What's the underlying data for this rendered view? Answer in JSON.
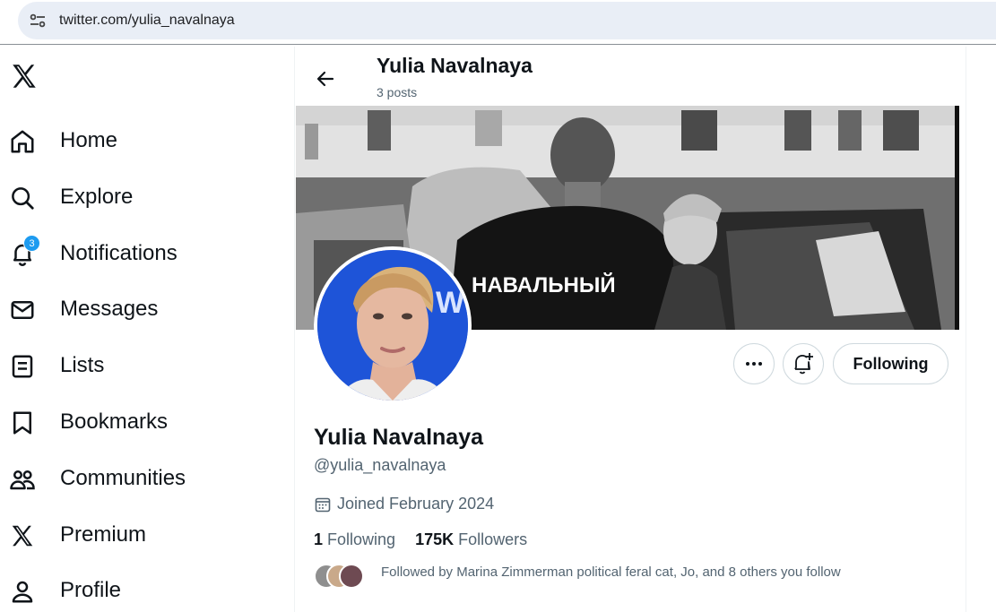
{
  "browser": {
    "url": "twitter.com/yulia_navalnaya"
  },
  "nav": {
    "logo": "x-logo-icon",
    "items": [
      {
        "label": "Home",
        "icon": "home-icon"
      },
      {
        "label": "Explore",
        "icon": "search-icon"
      },
      {
        "label": "Notifications",
        "icon": "bell-icon",
        "badge": "3"
      },
      {
        "label": "Messages",
        "icon": "envelope-icon"
      },
      {
        "label": "Lists",
        "icon": "list-icon"
      },
      {
        "label": "Bookmarks",
        "icon": "bookmark-icon"
      },
      {
        "label": "Communities",
        "icon": "communities-icon"
      },
      {
        "label": "Premium",
        "icon": "x-logo-icon"
      },
      {
        "label": "Profile",
        "icon": "person-icon"
      }
    ]
  },
  "header": {
    "name": "Yulia Navalnaya",
    "posts": "3 posts"
  },
  "banner": {
    "jacket_text": "НАВАЛЬНЫЙ"
  },
  "profile": {
    "name": "Yulia Navalnaya",
    "handle": "@yulia_navalnaya",
    "joined": "Joined February 2024",
    "following_count": "1",
    "following_label": "Following",
    "followers_count": "175K",
    "followers_label": "Followers",
    "followed_by": "Followed by Marina Zimmerman political feral cat, Jo, and 8 others you follow"
  },
  "actions": {
    "more": "more-icon",
    "notify": "bell-plus-icon",
    "follow_label": "Following"
  },
  "colors": {
    "accent": "#1d9bf0",
    "text": "#0f1419",
    "secondary": "#536471"
  }
}
